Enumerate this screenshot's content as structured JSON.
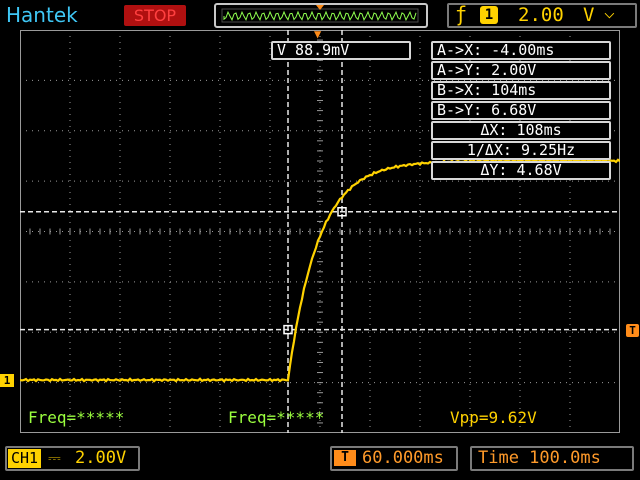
{
  "brand": "Hantek",
  "run_state": "STOP",
  "trigger": {
    "edge_icon": "rising-edge-icon",
    "channel": "1",
    "level": "2.00",
    "unit": "V",
    "coupling_arrow": "chevron-down-icon"
  },
  "cursor_readout": {
    "cursor_value": "V 88.9mV",
    "a_x": "A->X: -4.00ms",
    "a_y": "A->Y: 2.00V",
    "b_x": "B->X: 104ms",
    "b_y": "B->Y: 6.68V",
    "delta_x": "ΔX: 108ms",
    "inv_delta_x": "1/ΔX: 9.25Hz",
    "delta_y": "ΔY: 4.68V"
  },
  "measurements": {
    "freq_left": "Freq=*****",
    "freq_mid": "Freq=*****",
    "vpp": "Vpp=9.62V"
  },
  "channel1": {
    "tag": "CH1",
    "coupling": "⎓",
    "scale": "2.00V"
  },
  "trigger_position": {
    "icon": "T",
    "value": "60.000ms"
  },
  "timebase": {
    "label": "Time 100.0ms"
  },
  "markers": {
    "ch1": "1",
    "trigger_level": "T",
    "trigger_time": "▼"
  },
  "colors": {
    "trace": "#ffd200",
    "grid": "#bdbdbd",
    "brand": "#3fc7f5",
    "stop": "#ff4040"
  },
  "waveform": {
    "description_units": "ms and V",
    "baseline_v": 0.0,
    "step_time_ms": -4.0,
    "final_v": 8.7,
    "time_constant_ms": 60
  }
}
